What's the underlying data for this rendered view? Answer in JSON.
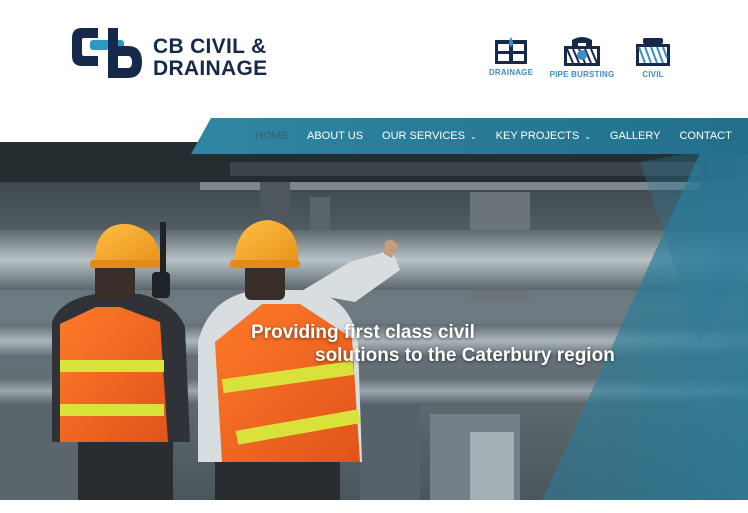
{
  "brand": {
    "line1": "CB CIVIL &",
    "line2": "DRAINAGE",
    "logo_monogram": "CB",
    "navy": "#17294a",
    "teal": "#2b7b99"
  },
  "services": [
    {
      "label": "DRAINAGE",
      "icon": "drainage-icon"
    },
    {
      "label": "PIPE BURSTING",
      "icon": "pipe-bursting-icon"
    },
    {
      "label": "CIVIL",
      "icon": "civil-icon"
    }
  ],
  "nav": {
    "items": [
      {
        "label": "HOME",
        "active": true
      },
      {
        "label": "ABOUT US"
      },
      {
        "label": "OUR SERVICES",
        "dropdown": true
      },
      {
        "label": "KEY PROJECTS",
        "dropdown": true
      },
      {
        "label": "GALLERY"
      },
      {
        "label": "CONTACT"
      }
    ],
    "dropdown_glyph": "⌄",
    "bg": "#2a7c9a"
  },
  "hero": {
    "line1": "Providing first class civil",
    "line2": "solutions to the Caterbury region"
  }
}
